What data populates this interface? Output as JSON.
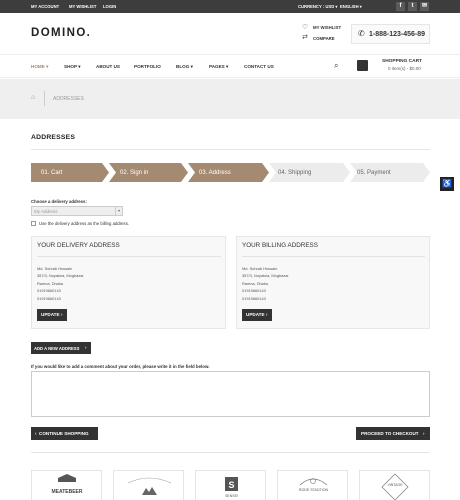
{
  "topbar": {
    "my_account": "MY ACCOUNT",
    "my_wishlist": "MY WISHLIST",
    "login": "LOGIN",
    "currency": "CURRENCY : USD",
    "language": "ENGLISH",
    "social_icons": [
      "facebook-icon",
      "twitter-icon",
      "email-icon"
    ],
    "facebook_glyph": "f",
    "twitter_glyph": "t",
    "email_glyph": "✉"
  },
  "header": {
    "logo": "DOMINO.",
    "wishlist": "MY WISHLIST",
    "compare": "COMPARE",
    "phone": "1-888-123-456-89"
  },
  "nav": {
    "items": [
      {
        "label": "HOME",
        "dropdown": true,
        "active": true
      },
      {
        "label": "SHOP",
        "dropdown": true
      },
      {
        "label": "ABOUT US",
        "dropdown": false
      },
      {
        "label": "PORTFOLIO",
        "dropdown": false
      },
      {
        "label": "BLOG",
        "dropdown": true
      },
      {
        "label": "PAGES",
        "dropdown": true
      },
      {
        "label": "CONTACT US",
        "dropdown": false
      }
    ],
    "cart_title": "SHOPPING CART",
    "cart_summary": "0 item(s) - $0.00"
  },
  "breadcrumb": {
    "current": "ADDRESSES"
  },
  "page": {
    "title": "ADDRESSES"
  },
  "steps": {
    "items": [
      {
        "label": "01. Cart",
        "state": "done"
      },
      {
        "label": "02. Sign in",
        "state": "done"
      },
      {
        "label": "03. Address",
        "state": "current"
      },
      {
        "label": "04. Shipping",
        "state": "todo"
      },
      {
        "label": "05. Payment",
        "state": "todo"
      }
    ],
    "colors": {
      "done": "#a58a72",
      "todo": "#ececec",
      "done_text": "#ffffff",
      "todo_text": "#666666"
    }
  },
  "delivery": {
    "choose_label": "Choose a delivery address:",
    "selected": "My Address",
    "use_same_label": "Use the delivery address as the billing address."
  },
  "delivery_box": {
    "title": "YOUR DELIVERY ADDRESS",
    "lines": [
      "Md. Sohrab Hossain",
      "357/3, Noyatola, Mogbazar",
      "Ramna, Dhaka",
      "01919660143",
      "01919660143"
    ],
    "button": "UPDATE"
  },
  "billing_box": {
    "title": "YOUR BILLING ADDRESS",
    "lines": [
      "Md. Sohrab Hossain",
      "357/3, Noyatola, Mogbazar",
      "Ramna, Dhaka",
      "01919660143",
      "01919660143"
    ],
    "button": "UPDATE"
  },
  "actions": {
    "add_address": "ADD A NEW ADDRESS",
    "comment_label": "If you would like to add a comment about your order, please write it in the field below.",
    "continue": "CONTINUE SHOPPING",
    "checkout": "PROCEED TO CHECKOUT"
  },
  "brands": {
    "items": [
      {
        "name": "MEATEBEER"
      },
      {
        "name": ""
      },
      {
        "name": "SENSEI"
      },
      {
        "name": "RODE STADTION"
      },
      {
        "name": "VINTAGE"
      }
    ]
  },
  "colors": {
    "accent": "#a58a72",
    "dark": "#333333"
  }
}
